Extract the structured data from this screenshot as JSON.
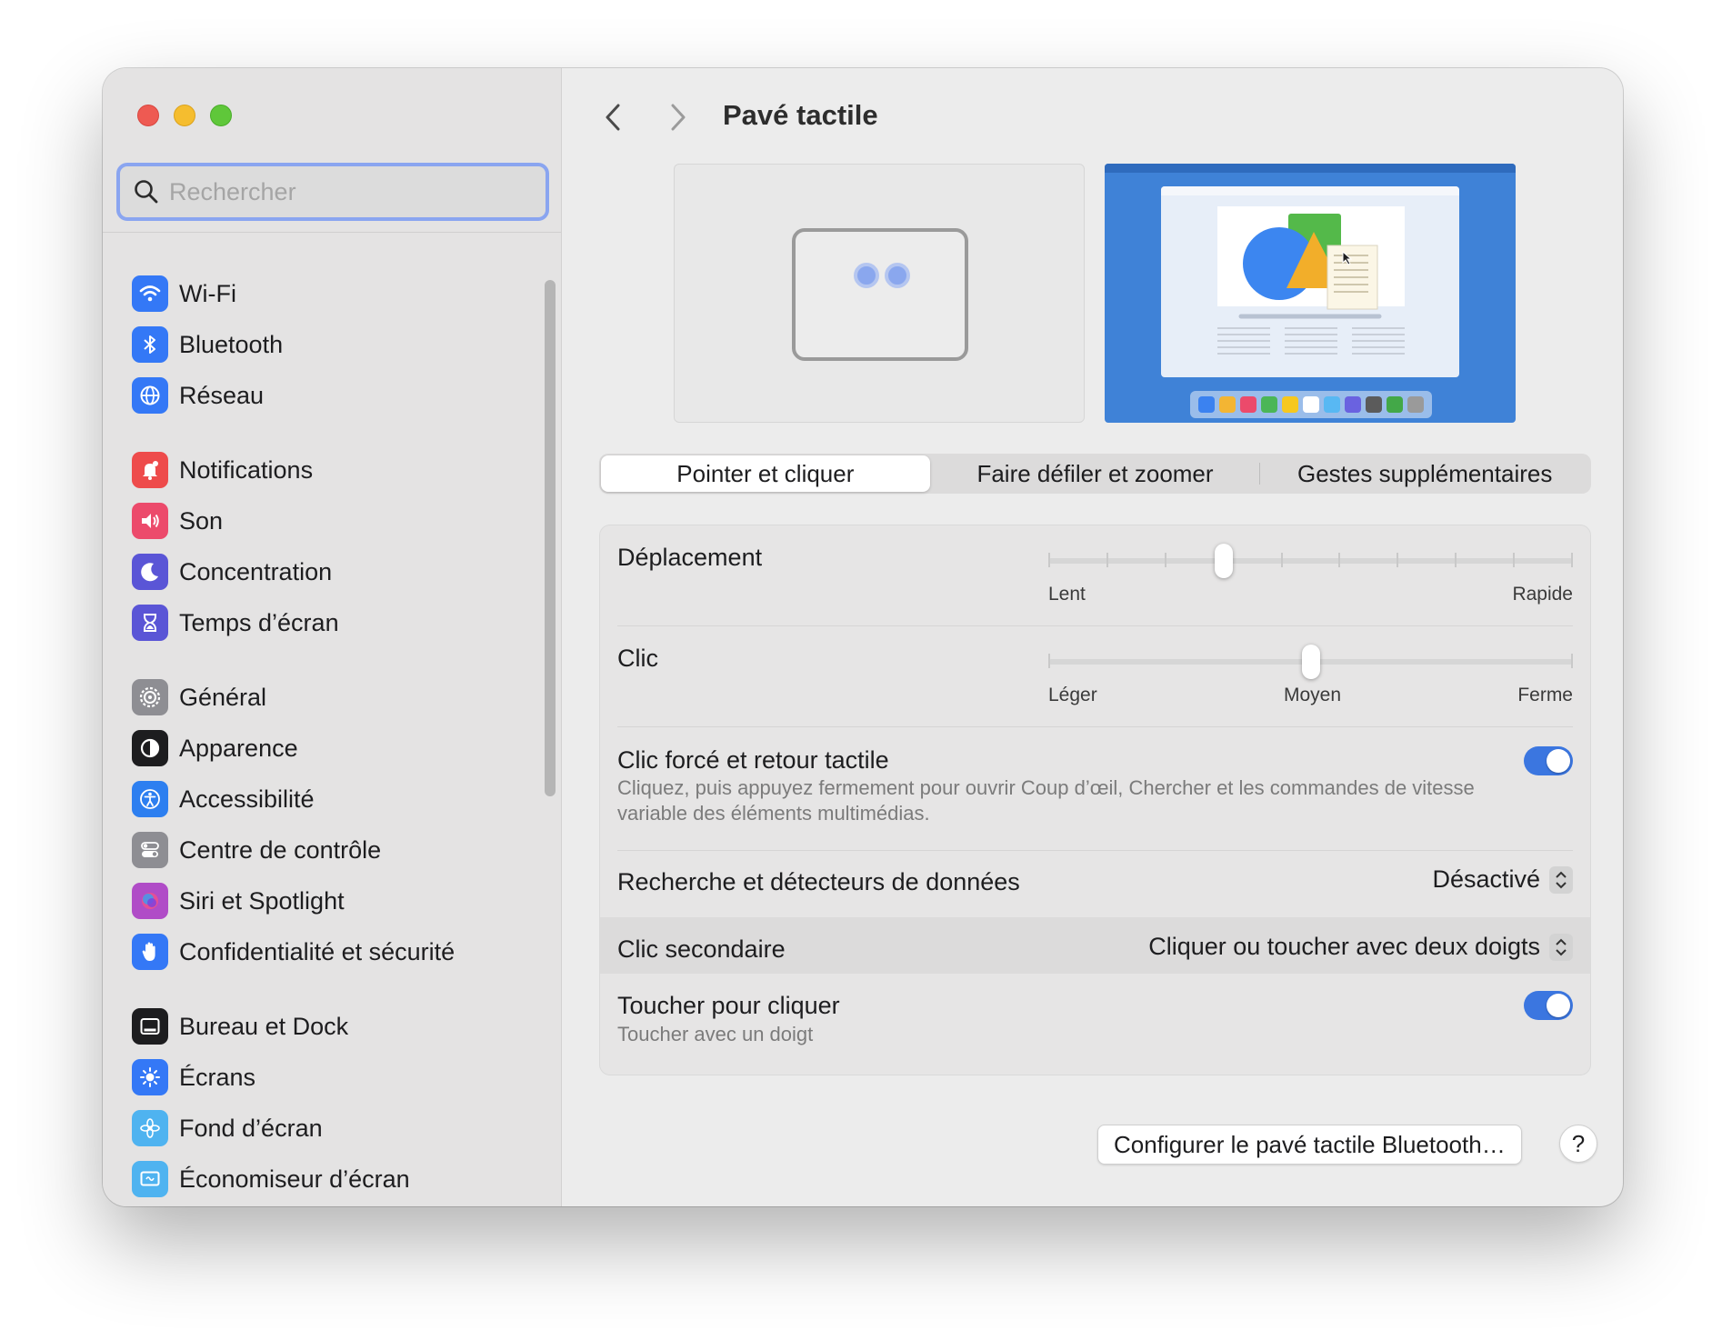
{
  "window": {
    "title": "Pavé tactile"
  },
  "search": {
    "placeholder": "Rechercher",
    "value": ""
  },
  "sidebar": {
    "groups": [
      [
        {
          "label": "Wi-Fi",
          "icon": "wifi-icon",
          "color": "#3478f6"
        },
        {
          "label": "Bluetooth",
          "icon": "bluetooth-icon",
          "color": "#3478f6"
        },
        {
          "label": "Réseau",
          "icon": "globe-icon",
          "color": "#3478f6"
        }
      ],
      [
        {
          "label": "Notifications",
          "icon": "bell-icon",
          "color": "#ee4b4b"
        },
        {
          "label": "Son",
          "icon": "speaker-icon",
          "color": "#ec4a6b"
        },
        {
          "label": "Concentration",
          "icon": "moon-icon",
          "color": "#5a55d6"
        },
        {
          "label": "Temps d’écran",
          "icon": "hourglass-icon",
          "color": "#5a55d6"
        }
      ],
      [
        {
          "label": "Général",
          "icon": "gear-icon",
          "color": "#8e8e93"
        },
        {
          "label": "Apparence",
          "icon": "appearance-icon",
          "color": "#1d1d1f"
        },
        {
          "label": "Accessibilité",
          "icon": "accessibility-icon",
          "color": "#2d7ff0"
        },
        {
          "label": "Centre de contrôle",
          "icon": "control-center-icon",
          "color": "#8e8e93"
        },
        {
          "label": "Siri et Spotlight",
          "icon": "siri-icon",
          "color": "#b04cc7"
        },
        {
          "label": "Confidentialité et sécurité",
          "icon": "hand-icon",
          "color": "#3478f6"
        }
      ],
      [
        {
          "label": "Bureau et Dock",
          "icon": "dock-icon",
          "color": "#1d1d1f"
        },
        {
          "label": "Écrans",
          "icon": "brightness-icon",
          "color": "#3478f6"
        },
        {
          "label": "Fond d’écran",
          "icon": "flower-icon",
          "color": "#4fb3f0"
        },
        {
          "label": "Économiseur d’écran",
          "icon": "screensaver-icon",
          "color": "#4fb3f0"
        }
      ]
    ]
  },
  "tabs": [
    {
      "label": "Pointer et cliquer",
      "active": true
    },
    {
      "label": "Faire défiler et zoomer",
      "active": false
    },
    {
      "label": "Gestes supplémentaires",
      "active": false
    }
  ],
  "settings": {
    "tracking": {
      "label": "Déplacement",
      "min_label": "Lent",
      "max_label": "Rapide",
      "position": 3,
      "steps": 10
    },
    "click": {
      "label": "Clic",
      "min_label": "Léger",
      "mid_label": "Moyen",
      "max_label": "Ferme",
      "position": 1,
      "steps": 3
    },
    "force_click": {
      "label": "Clic forcé et retour tactile",
      "description": "Cliquez, puis appuyez fermement pour ouvrir Coup d’œil, Chercher et les commandes de vitesse variable des éléments multimédias.",
      "enabled": true
    },
    "lookup": {
      "label": "Recherche et détecteurs de données",
      "value": "Désactivé"
    },
    "secondary_click": {
      "label": "Clic secondaire",
      "value": "Cliquer ou toucher avec deux doigts"
    },
    "tap_to_click": {
      "label": "Toucher pour cliquer",
      "description": "Toucher avec un doigt",
      "enabled": true
    }
  },
  "buttons": {
    "configure": "Configurer le pavé tactile Bluetooth…",
    "help": "?"
  },
  "colors": {
    "accent": "#3b76e0",
    "search_focus": "#8aa5f0"
  }
}
